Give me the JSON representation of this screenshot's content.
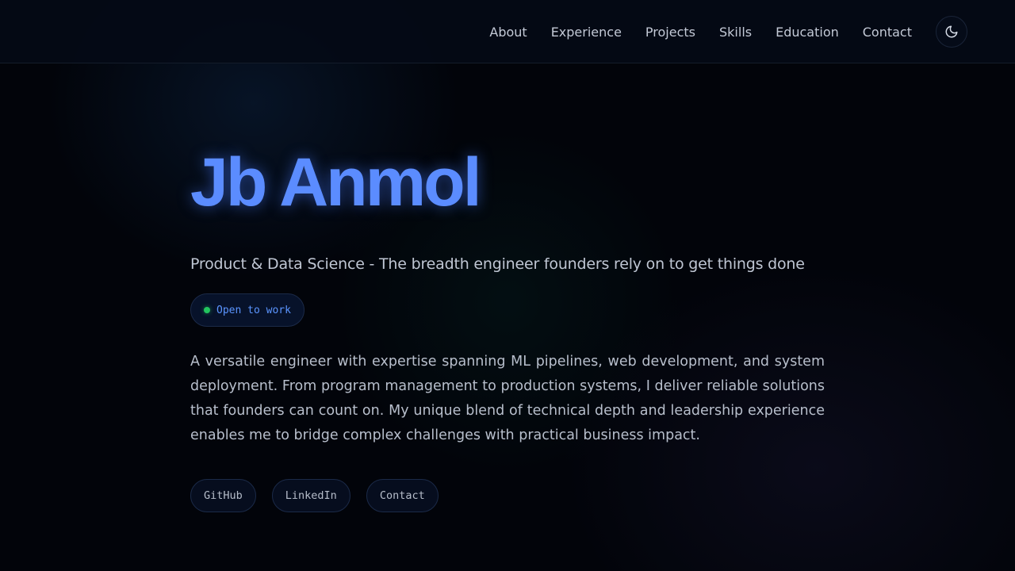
{
  "nav": {
    "items": [
      {
        "label": "About"
      },
      {
        "label": "Experience"
      },
      {
        "label": "Projects"
      },
      {
        "label": "Skills"
      },
      {
        "label": "Education"
      },
      {
        "label": "Contact"
      }
    ],
    "theme_toggle_icon": "moon-icon"
  },
  "hero": {
    "name": "Jb Anmol",
    "tagline": "Product & Data Science - The breadth engineer founders rely on to get things done",
    "status": {
      "label": "Open to work",
      "dot_color": "#22c55e"
    },
    "bio": "A versatile engineer with expertise spanning ML pipelines, web development, and system deployment. From program management to production systems, I deliver reliable solutions that founders can count on. My unique blend of technical depth and leadership experience enables me to bridge complex challenges with practical business impact.",
    "links": [
      {
        "label": "GitHub"
      },
      {
        "label": "LinkedIn"
      },
      {
        "label": "Contact"
      }
    ]
  },
  "colors": {
    "accent": "#5b8cff",
    "background": "#02040a",
    "status_green": "#22c55e"
  }
}
